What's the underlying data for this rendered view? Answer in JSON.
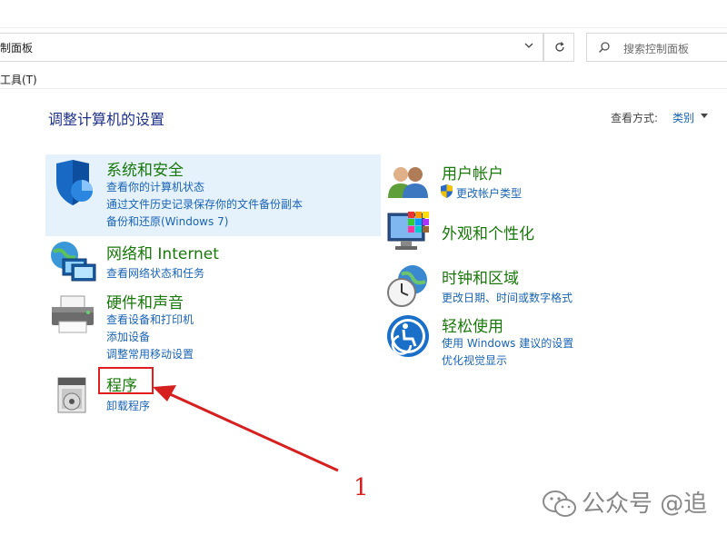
{
  "address_bar": {
    "text": "制面板"
  },
  "search": {
    "placeholder": "搜索控制面板"
  },
  "menu": {
    "tools": "工具(T)"
  },
  "main": {
    "title": "调整计算机的设置",
    "view_by_label": "查看方式:",
    "view_by_value": "类别"
  },
  "left_categories": [
    {
      "title": "系统和安全",
      "links": [
        "查看你的计算机状态",
        "通过文件历史记录保存你的文件备份副本",
        "备份和还原(Windows 7)"
      ]
    },
    {
      "title": "网络和 Internet",
      "links": [
        "查看网络状态和任务"
      ]
    },
    {
      "title": "硬件和声音",
      "links": [
        "查看设备和打印机",
        "添加设备",
        "调整常用移动设置"
      ]
    },
    {
      "title": "程序",
      "links": [
        "卸载程序"
      ]
    }
  ],
  "right_categories": [
    {
      "title": "用户帐户",
      "links": [
        "更改帐户类型"
      ]
    },
    {
      "title": "外观和个性化",
      "links": []
    },
    {
      "title": "时钟和区域",
      "links": [
        "更改日期、时间或数字格式"
      ]
    },
    {
      "title": "轻松使用",
      "links": [
        "使用 Windows 建议的设置",
        "优化视觉显示"
      ]
    }
  ],
  "annotation": {
    "number": "1",
    "color": "#d62020"
  },
  "watermark": {
    "text": "公众号 @追"
  },
  "colors": {
    "category_title": "#19780a",
    "link": "#1a64b4",
    "heading": "#1e3287",
    "highlight": "#e5f1fb"
  },
  "icons": [
    "shield-icon",
    "network-icon",
    "printer-icon",
    "programs-icon",
    "users-icon",
    "monitor-palette-icon",
    "clock-globe-icon",
    "ease-of-access-icon",
    "uac-shield-icon",
    "refresh-icon",
    "search-icon",
    "chevron-down-icon"
  ]
}
